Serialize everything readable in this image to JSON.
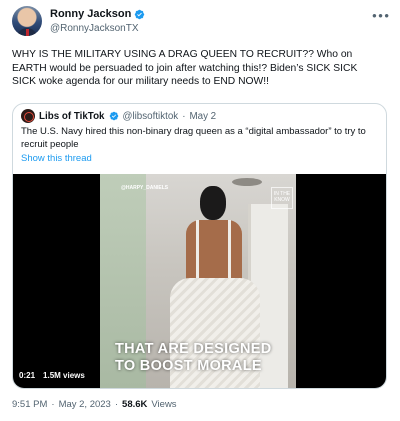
{
  "author": {
    "name": "Ronny Jackson",
    "handle": "@RonnyJacksonTX"
  },
  "tweet": {
    "text": "WHY IS THE MILITARY USING A DRAG QUEEN TO RECRUIT?? Who on EARTH would be persuaded to join after watching this!? Biden’s SICK SICK SICK woke agenda for our military needs to END NOW!!"
  },
  "quote": {
    "name": "Libs of TikTok",
    "handle": "@libsoftiktok",
    "sep": "·",
    "date": "May 2",
    "text": "The U.S. Navy hired this non-binary drag queen as a “digital ambassador” to try to recruit people",
    "show_thread": "Show this thread"
  },
  "video": {
    "caption_line1": "THAT ARE DESIGNED",
    "caption_line2": "TO BOOST MORALE",
    "watermark": "@HARPY_DANIELS",
    "badge": "IN THE KNOW",
    "duration": "0:21",
    "views": "1.5M views"
  },
  "meta": {
    "time": "9:51 PM",
    "sep1": "·",
    "date": "May 2, 2023",
    "sep2": "·",
    "views_count": "58.6K",
    "views_label": "Views"
  },
  "colors": {
    "link": "#1d9bf0",
    "secondary": "#536471",
    "border": "#cfd9de"
  },
  "icons": {
    "verified": "verified-badge-icon",
    "more": "more-horizontal-icon"
  }
}
